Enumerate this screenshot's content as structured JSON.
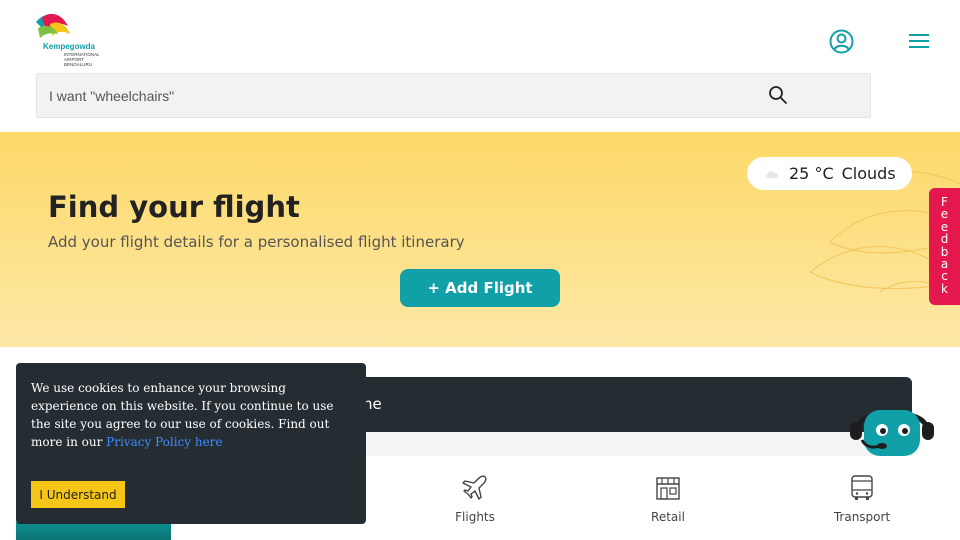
{
  "header": {
    "logo": {
      "name": "Kempegowda",
      "subtitle": "INTERNATIONAL\nAIRPORT\nBENGALURU"
    },
    "user_icon": "user-circle-icon",
    "menu_icon": "hamburger-menu-icon"
  },
  "search": {
    "placeholder": "I want \"wheelchairs\"",
    "icon": "search-icon"
  },
  "hero": {
    "weather": {
      "temperature": "25 °C",
      "condition": "Clouds",
      "icon": "cloud-icon"
    },
    "title": "Find your flight",
    "subtitle": "Add your flight details for a personalised flight itinerary",
    "add_flight_label": "+ Add Flight"
  },
  "feedback_label": "Feedback",
  "banner": {
    "text_fragment": "ne"
  },
  "nav": [
    {
      "label": "Flights",
      "icon": "airplane-icon"
    },
    {
      "label": "Retail",
      "icon": "store-icon"
    },
    {
      "label": "Transport",
      "icon": "bus-icon"
    }
  ],
  "cookie": {
    "text": "We use cookies to enhance your browsing experience on this website. If you continue to use the site you agree to our use of cookies. Find out more in our ",
    "link_text": "Privacy Policy here",
    "button_label": "I Understand"
  },
  "colors": {
    "teal": "#12a0a8",
    "hero_yellow": "#fdd968",
    "feedback_red": "#e4174e",
    "dark": "#252d33",
    "cookie_button": "#f5c518"
  }
}
